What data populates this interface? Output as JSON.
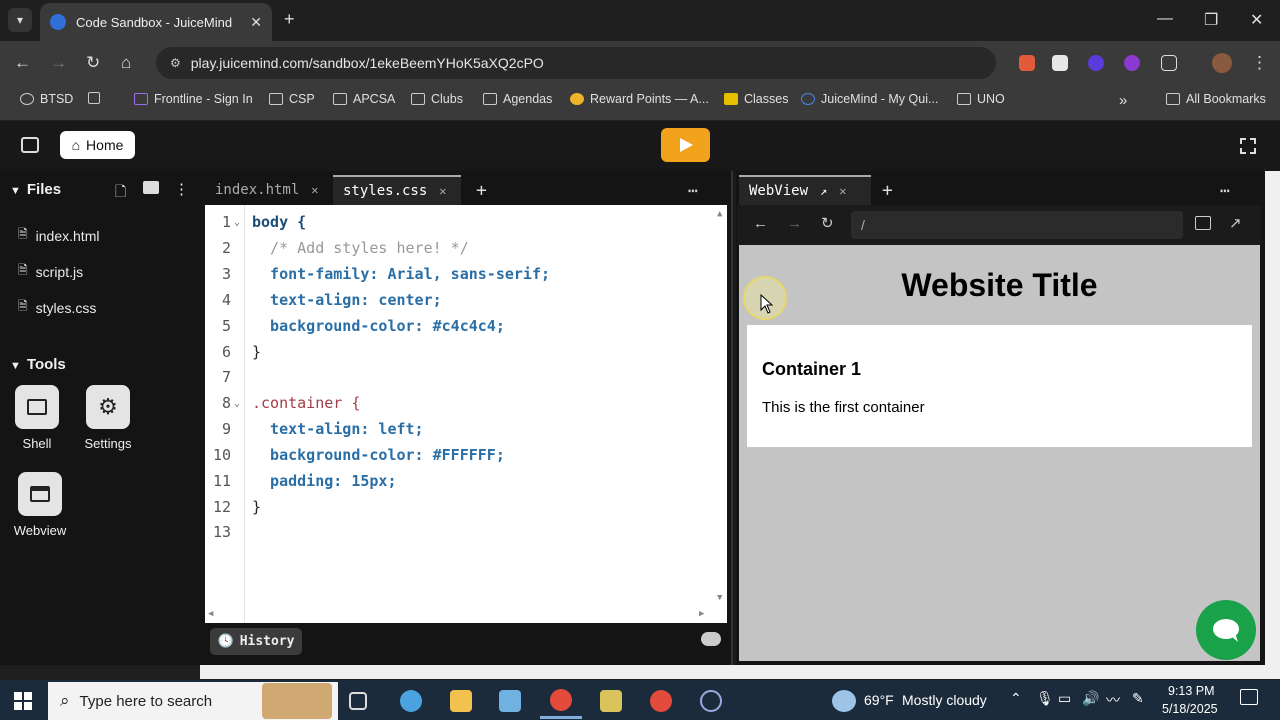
{
  "browser": {
    "tab_title": "Code Sandbox - JuiceMind",
    "url": "play.juicemind.com/sandbox/1ekeBeemYHoK5aXQ2cPO",
    "bookmarks": [
      "BTSD",
      "Frontline - Sign In",
      "CSP",
      "APCSA",
      "Clubs",
      "Agendas",
      "Reward Points — A...",
      "Classes",
      "JuiceMind - My Qui...",
      "UNO"
    ],
    "all_bookmarks": "All Bookmarks"
  },
  "app": {
    "home_label": "Home",
    "files_heading": "Files",
    "files": [
      "index.html",
      "script.js",
      "styles.css"
    ],
    "tools_heading": "Tools",
    "tools": [
      "Shell",
      "Settings",
      "Webview"
    ]
  },
  "editor": {
    "tabs": [
      "index.html",
      "styles.css"
    ],
    "active_tab": "styles.css",
    "history_label": "History",
    "line_numbers": [
      "1",
      "2",
      "3",
      "4",
      "5",
      "6",
      "7",
      "8",
      "9",
      "10",
      "11",
      "12",
      "13"
    ],
    "lines": [
      "body {",
      "  /* Add styles here! */",
      "  font-family: Arial, sans-serif;",
      "  text-align: center;",
      "  background-color: #c4c4c4;",
      "}",
      "",
      ".container {",
      "  text-align: left;",
      "  background-color: #FFFFFF;",
      "  padding: 15px;",
      "}",
      ""
    ]
  },
  "webview": {
    "tab_label": "WebView",
    "address": "/",
    "page_title": "Website Title",
    "container_heading": "Container 1",
    "container_text": "This is the first container"
  },
  "taskbar": {
    "search_placeholder": "Type here to search",
    "weather_temp": "69°F",
    "weather_text": "Mostly cloudy",
    "time": "9:13 PM",
    "date": "5/18/2025"
  },
  "colors": {
    "run_button": "#f2a21b",
    "chat_bubble": "#19a24a",
    "webview_bg": "#c4c4c4"
  }
}
